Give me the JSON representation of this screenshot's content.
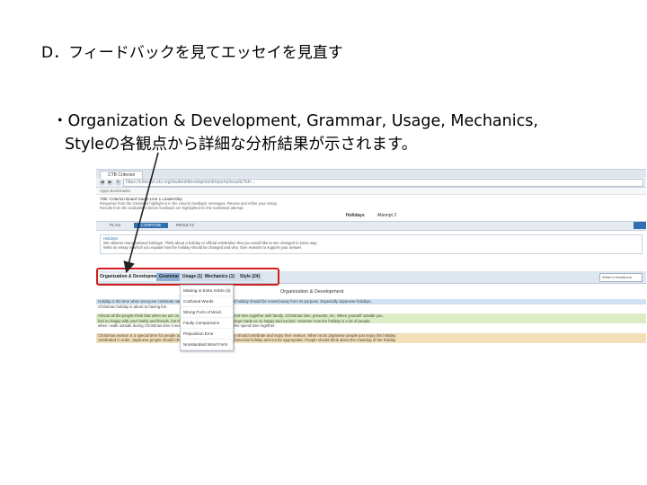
{
  "slide": {
    "title": "D．フィードバックを見てエッセイを見直す",
    "bullet_line1": "・Organization & Development, Grammar, Usage, Mechanics,",
    "bullet_line2": "Styleの各観点から詳細な分析結果が示されます。"
  },
  "screenshot": {
    "colors": {
      "highlight_box": "#d11f1f",
      "tab_active": "#2f6fb2"
    },
    "browser_tab": "CTB Criterion",
    "address": "https://criterion.ets.org/student/development/reports/results?id=…",
    "bookmarks": "Apps   Bookmarks",
    "criterion_title": "Title: Criterion Board Game Line 1 Leadership",
    "instructions": [
      "Response from the Grammar highlight is in the column feedback messages. Review and refine your essay.",
      "Results from the available Criterion feedback are highlighted for the submitted attempt."
    ],
    "essay_label": "Holidays",
    "attempt_label": "Attempt 2",
    "tabs": {
      "plan": "PLAN",
      "compose": "COMPOSE",
      "results": "RESULTS"
    },
    "prompt_label": "Holidays",
    "prompt_text": [
      "We observe many national holidays. Think about a holiday or official celebration that you would like to see changed in some way.",
      "Write an essay in which you explain how the holiday should be changed and why. Give reasons to support your answer."
    ],
    "categories": {
      "org": "Organization & Development",
      "grammar": "Grammar",
      "usage": "Usage (1)",
      "mechanics": "Mechanics (1)",
      "style": "Style (24)",
      "writers_handbook": "Writer's Handbook"
    },
    "dropdown_items": [
      "Missing or Extra Article (3)",
      "Confused Words",
      "Wrong Form of Word",
      "Faulty Comparisons",
      "Preposition Error",
      "Nonstandard Word Form"
    ],
    "essay_title": "Organization & Development",
    "paragraphs": [
      "Holiday is the time when everyone celebrate national holidays and our traditional holiday should be moved away from its purpose. Especially Japanese holidays.",
      "Christmas holiday is about to having fun.",
      "Almost all the people think that when we are on holiday we should be able to spend time together with family. Christmas time, presents, etc. When yourself outside you",
      "feel so happy with your family and friends, but the holiday is about all of those things made us so happy and excited. However now the holiday is a lot of people.",
      "when I walk outside during Christmas time it seems like only for those couples who spend time together.",
      "Christmas season is a special time for people to spend time together so that they should celebrate and enjoy their season. When most Japanese people just enjoy this holiday.",
      "celebrated in order. Japanese people should change the way they relate to a commercial holiday and not be appropriate. People should think about the meaning of the holiday."
    ]
  }
}
